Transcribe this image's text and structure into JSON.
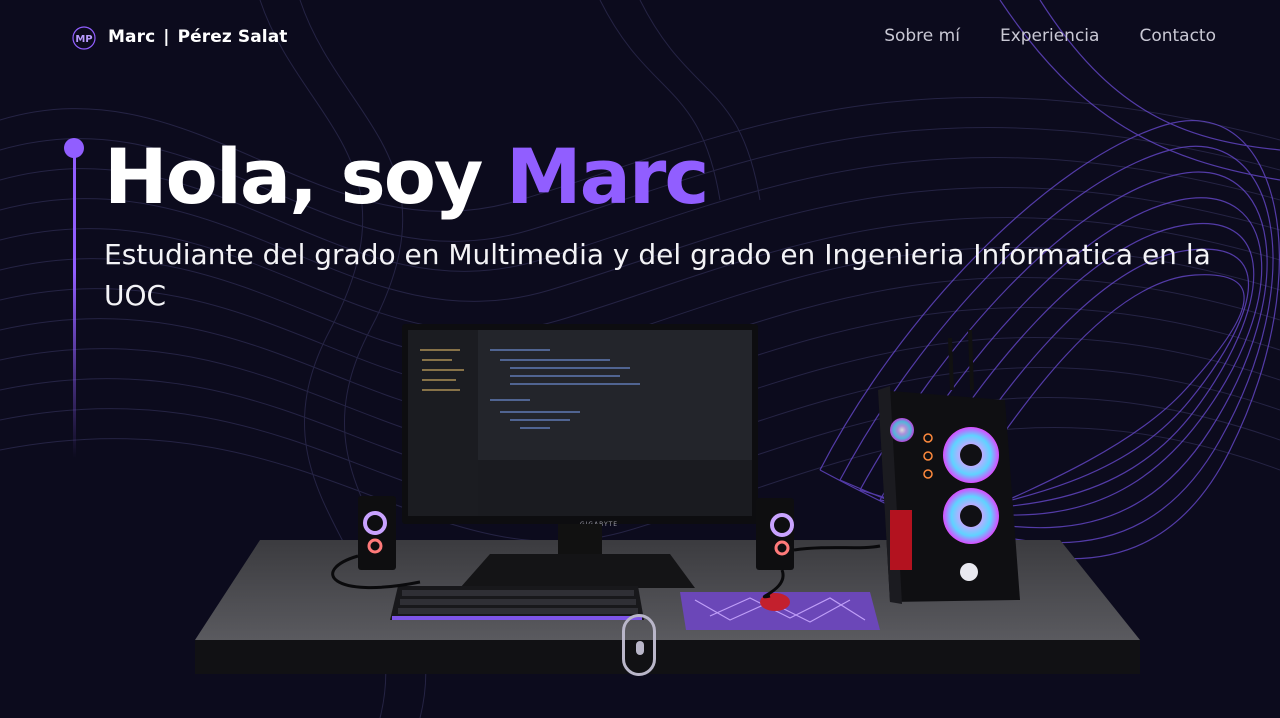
{
  "brand": {
    "logo_initials": "MP",
    "first_name": "Marc",
    "separator": "|",
    "last_name": "Pérez Salat"
  },
  "nav": {
    "items": [
      {
        "label": "Sobre mí"
      },
      {
        "label": "Experiencia"
      },
      {
        "label": "Contacto"
      }
    ]
  },
  "hero": {
    "greeting": "Hola, soy ",
    "name": "Marc",
    "subtitle": "Estudiante del grado en Multimedia y del grado en Ingenieria Informatica en la UOC"
  },
  "scene": {
    "monitor_brand": "GIGABYTE"
  },
  "colors": {
    "background": "#0c0b1d",
    "accent": "#915eff",
    "text": "#ffffff",
    "nav_text": "#c9c8d4"
  },
  "icons": {
    "logo": "mp-logo-icon",
    "scroll": "mouse-scroll-icon"
  }
}
